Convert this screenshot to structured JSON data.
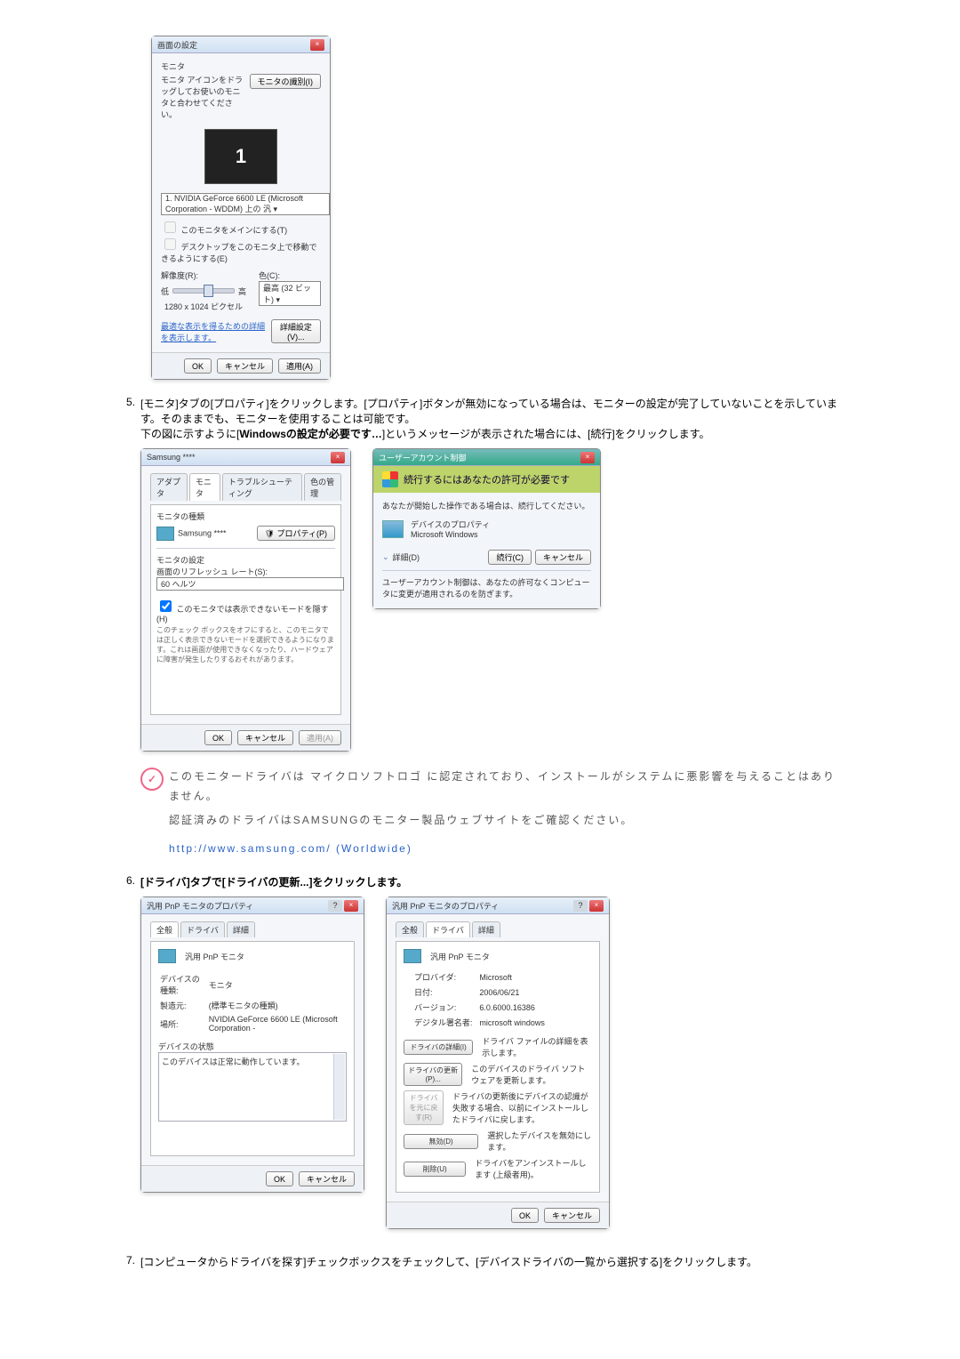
{
  "display_settings": {
    "title": "画面の設定",
    "section_label": "モニタ",
    "instruction": "モニタ アイコンをドラッグしてお使いのモニタと合わせてください。",
    "identify_btn": "モニタの識別(I)",
    "monitor_number": "1",
    "monitor_selector": "1. NVIDIA GeForce 6600 LE (Microsoft Corporation - WDDM) 上の 汎 ▾",
    "cb_main": "このモニタをメインにする(T)",
    "cb_extend": "デスクトップをこのモニタ上で移動できるようにする(E)",
    "resolution_label": "解像度(R):",
    "low": "低",
    "high": "高",
    "resolution_value": "1280 x 1024 ピクセル",
    "color_label": "色(C):",
    "color_value": "最高 (32 ビット) ▾",
    "best_link": "最適な表示を得るための詳細を表示します。",
    "adv_btn": "詳細設定(V)...",
    "ok": "OK",
    "cancel": "キャンセル",
    "apply": "適用(A)"
  },
  "step5": {
    "num": "5.",
    "text_a": "[モニタ]タブの[プロパティ]をクリックします。[プロパティ]ボタンが無効になっている場合は、モニターの設定が完了していないことを示しています。そのままでも、モニターを使用することは可能です。",
    "text_b_prefix": "下の図に示すように[",
    "text_b_bold": "Windowsの設定が必要です…",
    "text_b_suffix": "]というメッセージが表示された場合には、[続行]をクリックします。"
  },
  "monitor_props": {
    "title": "Samsung ****",
    "tabs": [
      "アダプタ",
      "モニタ",
      "トラブルシューティング",
      "色の管理"
    ],
    "type_label": "モニタの種類",
    "monitor_name": "Samsung ****",
    "prop_btn": "プロパティ(P)",
    "settings_label": "モニタの設定",
    "refresh_label": "画面のリフレッシュ レート(S):",
    "refresh_value": "60 ヘルツ",
    "cb_hide": "このモニタでは表示できないモードを隠す(H)",
    "cb_note": "このチェック ボックスをオフにすると、このモニタでは正しく表示できないモードを選択できるようになります。これは画面が使用できなくなったり、ハードウェアに障害が発生したりするおそれがあります。",
    "ok": "OK",
    "cancel": "キャンセル",
    "apply": "適用(A)"
  },
  "uac": {
    "title": "ユーザーアカウント制御",
    "header": "続行するにはあなたの許可が必要です",
    "line1": "あなたが開始した操作である場合は、続行してください。",
    "prop_name": "デバイスのプロパティ",
    "prop_vendor": "Microsoft Windows",
    "details": "詳細(D)",
    "continue": "続行(C)",
    "cancel": "キャンセル",
    "footer": "ユーザーアカウント制御は、あなたの許可なくコンピュータに変更が適用されるのを防ぎます。"
  },
  "note": {
    "line1": "このモニタードライバは マイクロソフトロゴ に認定されており、インストールがシステムに悪影響を与えることはありません。",
    "line2": "認証済みのドライバはSAMSUNGのモニター製品ウェブサイトをご確認ください。",
    "link": "http://www.samsung.com/ (Worldwide)"
  },
  "step6": {
    "num": "6.",
    "text": "[ドライバ]タブで[ドライバの更新...]をクリックします。"
  },
  "gen_props_left": {
    "title": "汎用 PnP モニタのプロパティ",
    "tabs": [
      "全般",
      "ドライバ",
      "詳細"
    ],
    "name": "汎用 PnP モニタ",
    "r1a": "デバイスの種類:",
    "r1b": "モニタ",
    "r2a": "製造元:",
    "r2b": "(標準モニタの種類)",
    "r3a": "場所:",
    "r3b": "NVIDIA GeForce 6600 LE (Microsoft Corporation -",
    "status_label": "デバイスの状態",
    "status_text": "このデバイスは正常に動作しています。",
    "ok": "OK",
    "cancel": "キャンセル"
  },
  "gen_props_right": {
    "title": "汎用 PnP モニタのプロパティ",
    "tabs": [
      "全般",
      "ドライバ",
      "詳細"
    ],
    "name": "汎用 PnP モニタ",
    "r1a": "プロバイダ:",
    "r1b": "Microsoft",
    "r2a": "日付:",
    "r2b": "2006/06/21",
    "r3a": "バージョン:",
    "r3b": "6.0.6000.16386",
    "r4a": "デジタル署名者:",
    "r4b": "microsoft windows",
    "btn1": "ドライバの詳細(I)",
    "txt1": "ドライバ ファイルの詳細を表示します。",
    "btn2": "ドライバの更新(P)...",
    "txt2": "このデバイスのドライバ ソフトウェアを更新します。",
    "btn3": "ドライバを元に戻す(R)",
    "txt3": "ドライバの更新後にデバイスの認識が失敗する場合、以前にインストールしたドライバに戻します。",
    "btn4": "無効(D)",
    "txt4": "選択したデバイスを無効にします。",
    "btn5": "削除(U)",
    "txt5": "ドライバをアンインストールします (上級者用)。",
    "ok": "OK",
    "cancel": "キャンセル"
  },
  "step7": {
    "num": "7.",
    "text": "[コンピュータからドライバを探す]チェックボックスをチェックして、[デバイスドライバの一覧から選択する]をクリックします。"
  }
}
